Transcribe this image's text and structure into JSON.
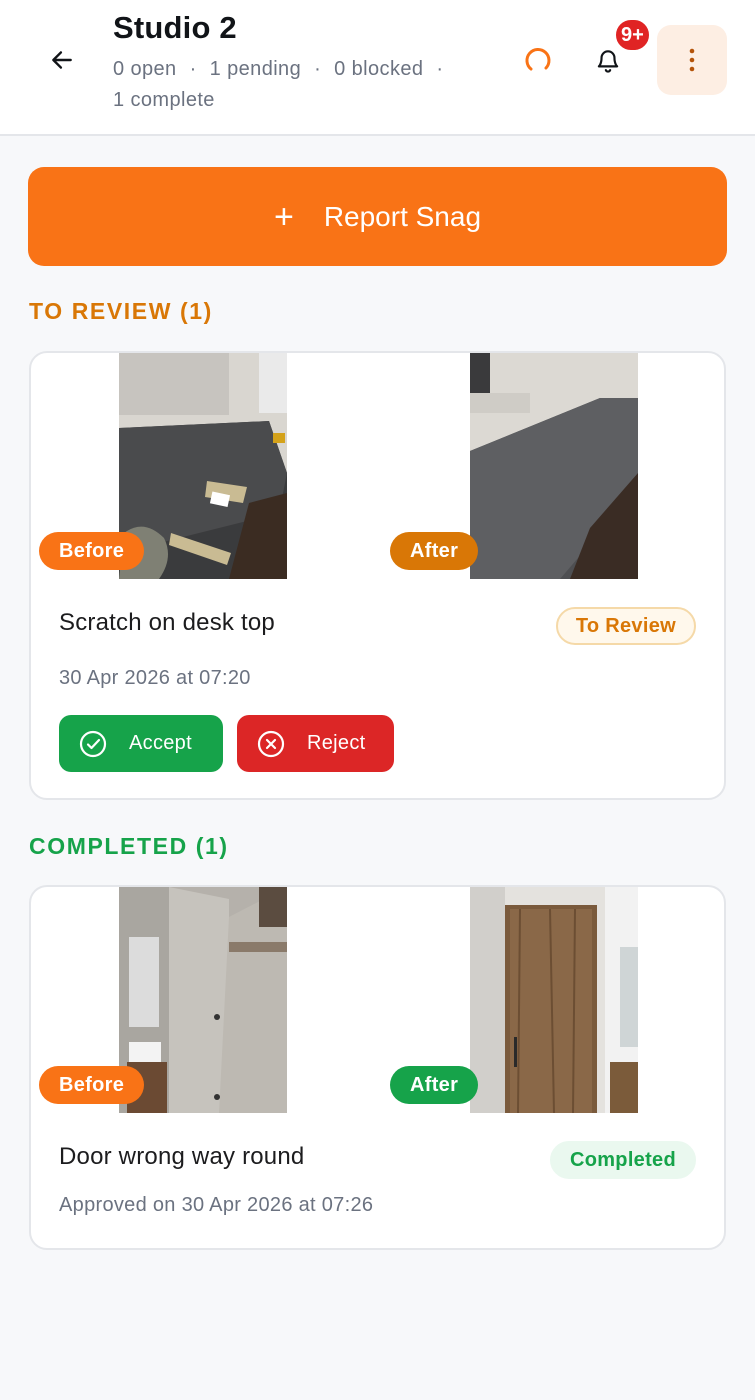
{
  "header": {
    "title": "Studio 2",
    "stats": {
      "open": "0 open",
      "pending": "1 pending",
      "blocked": "0 blocked",
      "complete": "1 complete",
      "separator": "·"
    },
    "notification_count": "9+",
    "icons": [
      "back-arrow-icon",
      "loading-spinner-icon",
      "bell-icon",
      "more-vertical-icon"
    ]
  },
  "report_button": {
    "icon": "+",
    "label": "Report Snag"
  },
  "sections": {
    "to_review": {
      "heading": "TO REVIEW (1)",
      "card": {
        "before_label": "Before",
        "after_label": "After",
        "title": "Scratch on desk top",
        "status": "To Review",
        "date": "30 Apr 2026 at 07:20",
        "accept_label": "Accept",
        "reject_label": "Reject"
      }
    },
    "completed": {
      "heading": "COMPLETED (1)",
      "card": {
        "before_label": "Before",
        "after_label": "After",
        "title": "Door wrong way round",
        "status": "Completed",
        "date": "Approved on 30 Apr 2026 at 07:26"
      }
    }
  },
  "colors": {
    "accent_orange": "#f97316",
    "review_amber": "#d97706",
    "success_green": "#16a34a",
    "danger_red": "#dc2626",
    "notification_red": "#e02424"
  }
}
